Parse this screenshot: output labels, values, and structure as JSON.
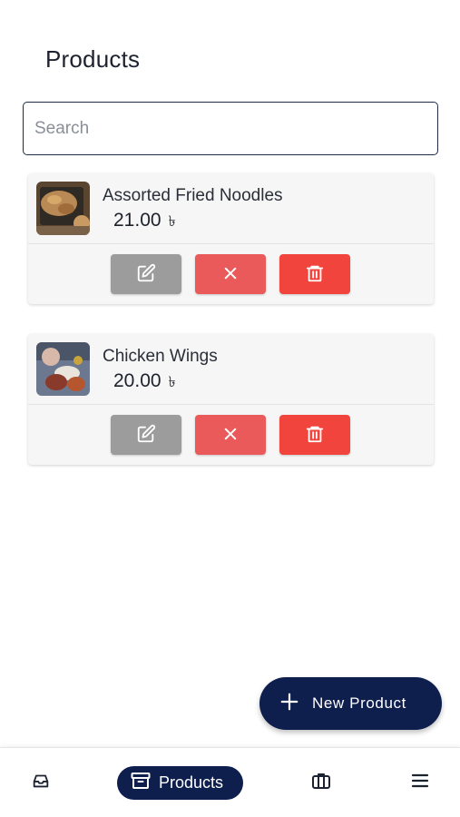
{
  "header": {
    "title": "Products"
  },
  "search": {
    "placeholder": "Search",
    "value": ""
  },
  "products": [
    {
      "name": "Assorted Fried Noodles",
      "price": "21.00",
      "currency": "৳",
      "image": "noodles-photo"
    },
    {
      "name": "Chicken Wings",
      "price": "20.00",
      "currency": "৳",
      "image": "wings-photo"
    }
  ],
  "actions": {
    "edit_icon": "edit-icon",
    "cancel_icon": "close-icon",
    "delete_icon": "trash-icon"
  },
  "fab": {
    "label": "New Product",
    "icon": "plus-icon"
  },
  "bottom_nav": {
    "items": [
      {
        "icon": "inbox-icon",
        "label": ""
      },
      {
        "icon": "archive-icon",
        "label": "Products",
        "active": true
      },
      {
        "icon": "briefcase-icon",
        "label": ""
      },
      {
        "icon": "menu-icon",
        "label": ""
      }
    ]
  },
  "colors": {
    "primary": "#0e1f4d",
    "edit": "#9c9c9c",
    "cancel": "#ea5a5a",
    "delete": "#f1443d"
  }
}
